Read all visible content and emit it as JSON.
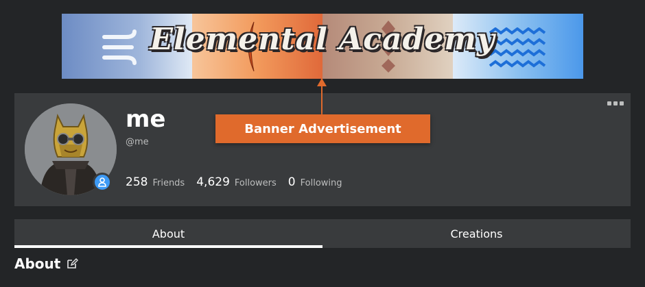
{
  "banner": {
    "title": "Elemental Academy",
    "segments": [
      "air",
      "fire",
      "earth",
      "water"
    ]
  },
  "callout": {
    "label": "Banner Advertisement",
    "color": "#e06a2c"
  },
  "profile": {
    "display_name": "me",
    "username": "@me",
    "presence_icon": "user-icon",
    "stats": [
      {
        "value": "258",
        "label": "Friends"
      },
      {
        "value": "4,629",
        "label": "Followers"
      },
      {
        "value": "0",
        "label": "Following"
      }
    ],
    "more_icon": "more-options-icon"
  },
  "tabs": [
    {
      "label": "About",
      "active": true
    },
    {
      "label": "Creations",
      "active": false
    }
  ],
  "about": {
    "heading": "About",
    "edit_icon": "edit-icon"
  },
  "colors": {
    "background": "#232527",
    "card": "#393b3d",
    "accent_blue": "#3d9af5",
    "muted_text": "#bdbebe"
  }
}
